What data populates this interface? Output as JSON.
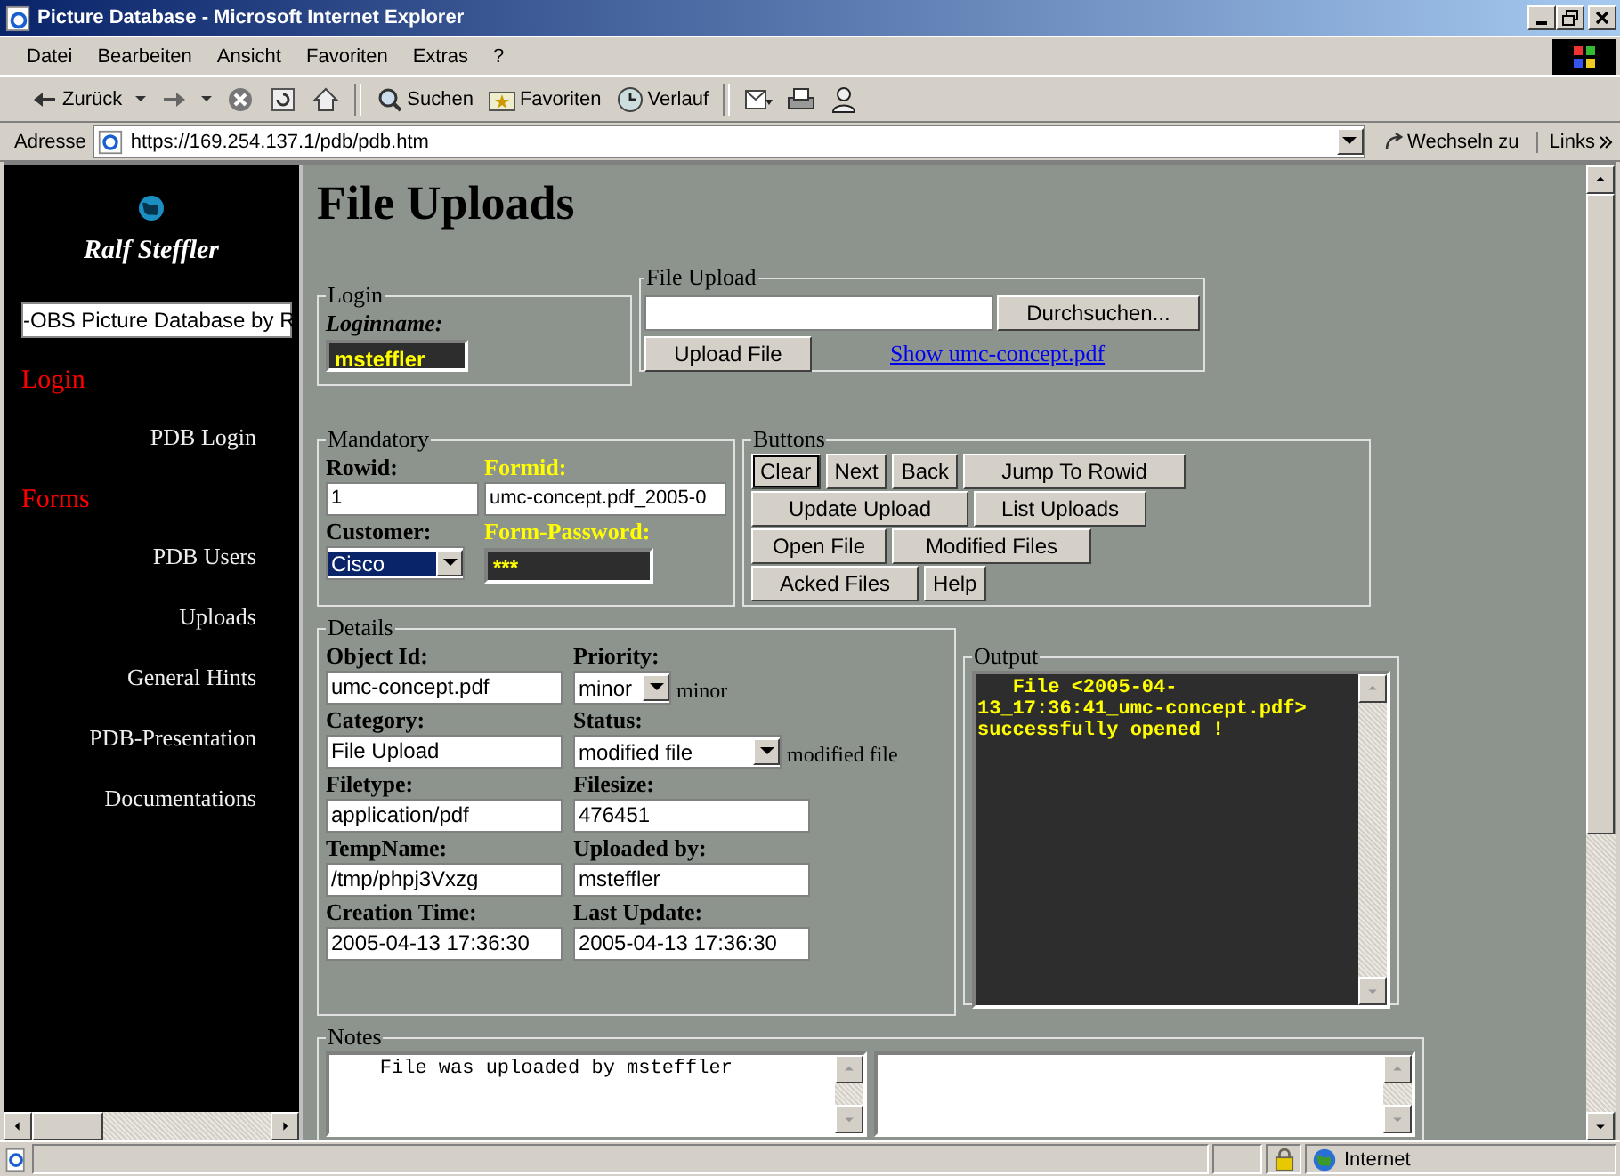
{
  "window": {
    "title": "Picture Database - Microsoft Internet Explorer"
  },
  "menu": [
    "Datei",
    "Bearbeiten",
    "Ansicht",
    "Favoriten",
    "Extras",
    "?"
  ],
  "toolbar": [
    {
      "kind": "back",
      "label": "Zurück"
    },
    {
      "kind": "forward"
    },
    {
      "kind": "stop"
    },
    {
      "kind": "refresh"
    },
    {
      "kind": "home"
    },
    {
      "kind": "search",
      "label": "Suchen"
    },
    {
      "kind": "favorites",
      "label": "Favoriten"
    },
    {
      "kind": "history",
      "label": "Verlauf"
    },
    {
      "kind": "mail"
    },
    {
      "kind": "print"
    },
    {
      "kind": "people"
    }
  ],
  "address": {
    "label": "Adresse",
    "url": "https://169.254.137.1/pdb/pdb.htm",
    "go": "Wechseln zu",
    "links": "Links"
  },
  "sidebar": {
    "logo": "Ralf Steffler",
    "select_value": "-OBS Picture Database by R",
    "sections": [
      {
        "heading": "Login",
        "items": [
          "PDB Login"
        ]
      },
      {
        "heading": "Forms",
        "items": [
          "PDB Users",
          "Uploads",
          "General Hints",
          "PDB-Presentation",
          "Documentations"
        ]
      }
    ]
  },
  "page": {
    "heading": "File Uploads",
    "login": {
      "legend": "Login",
      "label": "Loginname:",
      "value": "msteffler"
    },
    "file_upload": {
      "legend": "File Upload",
      "browse": "Durchsuchen...",
      "upload": "Upload File",
      "link": "Show umc-concept.pdf"
    },
    "mandatory": {
      "legend": "Mandatory",
      "fields": [
        {
          "label": "Rowid:",
          "value": "1",
          "kind": "text",
          "color": "#000000"
        },
        {
          "label": "Formid:",
          "value": "umc-concept.pdf_2005-0",
          "kind": "text",
          "color": "#ffff00"
        },
        {
          "label": "Customer:",
          "value": "Cisco",
          "kind": "select",
          "color": "#000000"
        },
        {
          "label": "Form-Password:",
          "value": "***",
          "kind": "password",
          "color": "#ffff00"
        }
      ]
    },
    "buttons": {
      "legend": "Buttons",
      "items": [
        "Clear",
        "Next",
        "Back",
        "Jump To Rowid",
        "Update Upload",
        "List Uploads",
        "Open File",
        "Modified Files",
        "Acked Files",
        "Help"
      ]
    },
    "details": {
      "legend": "Details",
      "fields": [
        {
          "label": "Object Id:",
          "value": "umc-concept.pdf",
          "kind": "text"
        },
        {
          "label": "Priority:",
          "value": "minor",
          "kind": "select",
          "note": "minor"
        },
        {
          "label": "Category:",
          "value": "File Upload",
          "kind": "text"
        },
        {
          "label": "Status:",
          "value": "modified file",
          "kind": "select",
          "note": "modified file"
        },
        {
          "label": "Filetype:",
          "value": "application/pdf",
          "kind": "text"
        },
        {
          "label": "Filesize:",
          "value": "476451",
          "kind": "text"
        },
        {
          "label": "TempName:",
          "value": "/tmp/phpj3Vxzg",
          "kind": "text"
        },
        {
          "label": "Uploaded by:",
          "value": "msteffler",
          "kind": "text"
        },
        {
          "label": "Creation Time:",
          "value": "2005-04-13 17:36:30",
          "kind": "text"
        },
        {
          "label": "Last Update:",
          "value": "2005-04-13 17:36:30",
          "kind": "text"
        }
      ]
    },
    "output": {
      "legend": "Output",
      "text": "   File <2005-04-13_17:36:41_umc-concept.pdf> successfully opened !"
    },
    "notes": {
      "legend": "Notes",
      "text": "    File was uploaded by msteffler"
    }
  },
  "status_bar": {
    "zone": "Internet"
  }
}
